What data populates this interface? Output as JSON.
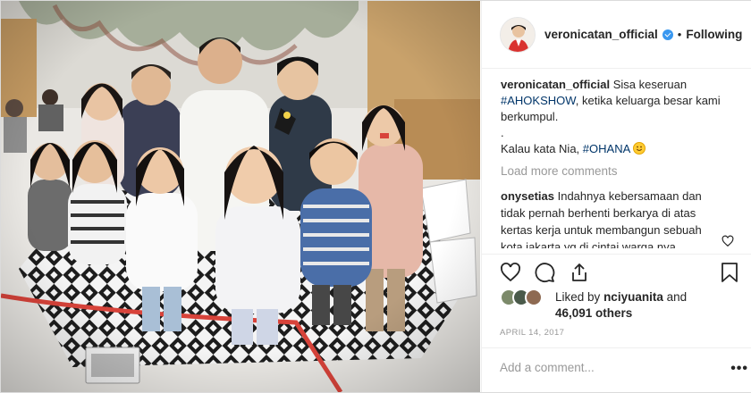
{
  "post": {
    "username": "veronicatan_official",
    "separator": "•",
    "follow_state": "Following"
  },
  "caption": {
    "username": "veronicatan_official",
    "text_1": "Sisa keseruan",
    "hashtag_1": "#AHOKSHOW",
    "text_2": ", ketika keluarga besar kami berkumpul.",
    "dot_line": ".",
    "text_3": "Kalau kata Nia,",
    "hashtag_2": "#OHANA"
  },
  "load_more": "Load more comments",
  "comment": {
    "username": "onysetias",
    "text": "Indahnya kebersamaan dan tidak pernah berhenti berkarya di atas kertas kerja untuk membangun sebuah kota jakarta yg di cintai warga nya"
  },
  "likes": {
    "prefix": "Liked by",
    "user": "nciyuanita",
    "and": "and",
    "others": "46,091 others"
  },
  "date": "APRIL 14, 2017",
  "add_comment_placeholder": "Add a comment...",
  "more_options": "•••",
  "icons": [
    "verified-badge-icon",
    "heart-icon",
    "comment-icon",
    "share-icon",
    "bookmark-icon",
    "smile-emoji-icon",
    "more-options-icon"
  ],
  "colors": {
    "verified": "#3897f0",
    "hashtag": "#003569",
    "muted": "#999999",
    "border": "#efefef"
  }
}
